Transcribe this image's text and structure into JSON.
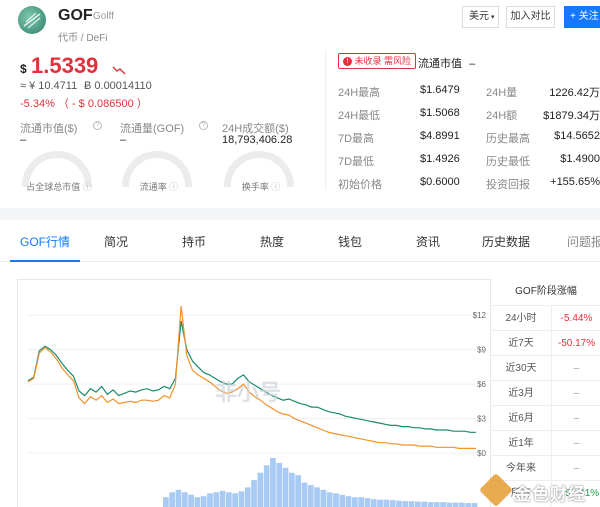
{
  "brand": {
    "name": "GOF",
    "sub": "Golff",
    "category": "代币 / DeFi"
  },
  "header": {
    "currency": "美元",
    "compare": "加入对比",
    "follow": "关注"
  },
  "price": {
    "symbol": "$",
    "value": "1.5339",
    "cny": "≈ ¥ 10.4711",
    "btc": "Ƀ 0.00014110",
    "change": "-5.34% （ - $ 0.086500 ）"
  },
  "risk_badge": "未收录 需风险",
  "circ_title": "流通市值",
  "circ_title_val": "–",
  "stats_left": [
    {
      "label": "流通市值($)",
      "value": "–",
      "gauge": "占全球总市值"
    },
    {
      "label": "流通量(GOF)",
      "value": "–",
      "gauge": "流通率"
    },
    {
      "label": "24H成交额($)",
      "value": "18,793,406.28",
      "gauge": "换手率"
    }
  ],
  "stats_mid": [
    {
      "label": "24H最高",
      "value": "$1.6479"
    },
    {
      "label": "24H最低",
      "value": "$1.5068"
    },
    {
      "label": "7D最高",
      "value": "$4.8991"
    },
    {
      "label": "7D最低",
      "value": "$1.4926"
    },
    {
      "label": "初始价格",
      "value": "$0.6000"
    }
  ],
  "stats_right": [
    {
      "label": "24H量",
      "value": "1226.42万"
    },
    {
      "label": "24H额",
      "value": "$1879.34万"
    },
    {
      "label": "历史最高",
      "value": "$14.5652"
    },
    {
      "label": "历史最低",
      "value": "$1.4900"
    },
    {
      "label": "投资回报",
      "value": "+155.65%"
    }
  ],
  "tabs": [
    "GOF行情",
    "简况",
    "持币",
    "热度",
    "钱包",
    "资讯",
    "历史数据",
    "问题报"
  ],
  "perf": {
    "title": "GOF阶段涨幅",
    "rows": [
      {
        "period": "24小时",
        "value": "-5.44%"
      },
      {
        "period": "近7天",
        "value": "-50.17%"
      },
      {
        "period": "近30天",
        "value": "–"
      },
      {
        "period": "近3月",
        "value": "–"
      },
      {
        "period": "近6月",
        "value": "–"
      },
      {
        "period": "近1年",
        "value": "–"
      },
      {
        "period": "今年来",
        "value": "–"
      },
      {
        "period": "所有",
        "value": "+155.41%"
      }
    ]
  },
  "watermark": "非小号",
  "watermark2": "金色财经",
  "chart_data": {
    "type": "line",
    "yticks": [
      "$12",
      "$9",
      "$6",
      "$3",
      "$0"
    ],
    "ylim": [
      0,
      13.5
    ],
    "series": [
      {
        "color": "#1a8a6e",
        "values": [
          6.3,
          6.6,
          8.9,
          9.3,
          9.0,
          8.5,
          7.8,
          7.2,
          6.7,
          5.4,
          5.0,
          5.6,
          5.3,
          5.8,
          5.1,
          5.5,
          5.0,
          5.2,
          5.4,
          5.3,
          5.5,
          5.6,
          5.4,
          5.5,
          5.8,
          5.6,
          6.5,
          11.5,
          9.0,
          8.0,
          7.5,
          7.0,
          6.8,
          6.5,
          6.2,
          6.0,
          6.0,
          6.5,
          6.8,
          6.2,
          5.9,
          5.6,
          5.3,
          5.0,
          4.8,
          4.6,
          4.7,
          4.5,
          4.3,
          4.2,
          4.0,
          4.0,
          3.8,
          3.6,
          3.5,
          3.4,
          3.2,
          3.1,
          3.0,
          2.9,
          2.8,
          2.7,
          2.6,
          2.5,
          2.4,
          2.4,
          2.3,
          2.3,
          2.2,
          2.2,
          2.1,
          2.1,
          2.0,
          2.0,
          2.0,
          1.9,
          1.9,
          1.9,
          1.8,
          1.8
        ]
      },
      {
        "color": "#f0932b",
        "values": [
          6.2,
          6.5,
          8.7,
          9.2,
          8.8,
          8.2,
          7.4,
          6.8,
          6.3,
          4.8,
          4.3,
          4.9,
          4.6,
          5.0,
          4.4,
          4.7,
          4.3,
          4.4,
          4.5,
          4.4,
          4.6,
          4.6,
          4.5,
          4.6,
          5.0,
          4.8,
          6.0,
          12.8,
          8.5,
          7.2,
          6.8,
          6.5,
          6.2,
          5.8,
          5.4,
          5.2,
          5.3,
          5.6,
          6.0,
          5.3,
          4.9,
          4.6,
          4.2,
          3.9,
          3.6,
          3.4,
          3.3,
          3.0,
          2.8,
          2.6,
          2.4,
          2.2,
          2.0,
          1.8,
          1.7,
          1.6,
          1.5,
          1.4,
          1.3,
          1.2,
          1.1,
          1.0,
          0.9,
          0.9,
          0.8,
          0.8,
          0.7,
          0.7,
          0.7,
          0.6,
          0.6,
          0.6,
          0.5,
          0.5,
          0.5,
          0.5,
          0.4,
          0.4,
          0.4,
          0.4
        ]
      }
    ],
    "volume": [
      0.2,
      0.3,
      0.35,
      0.3,
      0.25,
      0.2,
      0.22,
      0.28,
      0.3,
      0.33,
      0.3,
      0.28,
      0.32,
      0.4,
      0.55,
      0.7,
      0.85,
      1.0,
      0.9,
      0.8,
      0.7,
      0.65,
      0.5,
      0.45,
      0.4,
      0.35,
      0.3,
      0.28,
      0.25,
      0.22,
      0.2,
      0.2,
      0.18,
      0.16,
      0.15,
      0.15,
      0.14,
      0.13,
      0.12,
      0.12,
      0.11,
      0.11,
      0.1,
      0.1,
      0.1,
      0.09,
      0.09,
      0.09,
      0.08,
      0.08
    ]
  }
}
